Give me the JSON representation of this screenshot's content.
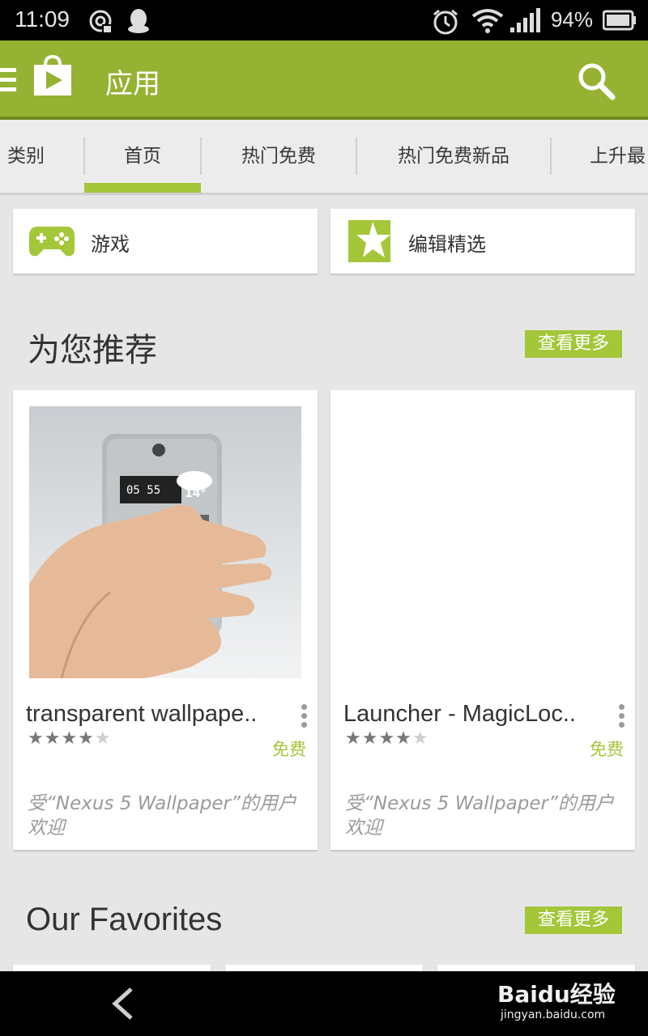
{
  "status": {
    "time": "11:09",
    "battery_percent": "94%"
  },
  "appbar": {
    "title": "应用"
  },
  "tabs": [
    {
      "label": "类别"
    },
    {
      "label": "首页"
    },
    {
      "label": "热门免费"
    },
    {
      "label": "热门免费新品"
    },
    {
      "label": "上升最"
    }
  ],
  "chips": [
    {
      "label": "游戏"
    },
    {
      "label": "编辑精选"
    }
  ],
  "sections": {
    "recommended": {
      "title": "为您推荐",
      "more_label": "查看更多"
    },
    "favorites": {
      "title": "Our Favorites",
      "more_label": "查看更多"
    }
  },
  "apps": [
    {
      "name": "transparent wallpape..",
      "rating_stars": 4,
      "price": "免费",
      "reason": "受“Nexus 5 Wallpaper”的用户欢迎"
    },
    {
      "name": "Launcher - MagicLoc..",
      "rating_stars": 4,
      "price": "免费",
      "reason": "受“Nexus 5 Wallpaper”的用户欢迎"
    }
  ],
  "phone_screen": {
    "clock": "05 55",
    "temp": "14°"
  },
  "watermark": {
    "brand": "Baidu经验",
    "url": "jingyan.baidu.com"
  },
  "colors": {
    "appbar": "#95b233",
    "accent": "#a4c639"
  }
}
